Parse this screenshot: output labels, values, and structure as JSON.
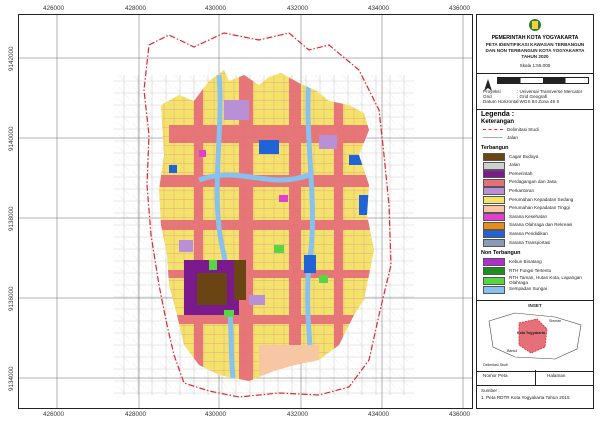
{
  "x_ticks": [
    "426000",
    "428000",
    "430000",
    "432000",
    "434000",
    "436000"
  ],
  "y_ticks": [
    "9142000",
    "9140000",
    "9138000",
    "9136000",
    "9134000"
  ],
  "title_block": {
    "org": "PEMERINTAH KOTA YOGYAKARTA",
    "map_title": "PETA IDENTIFIKASI KAWASAN TERBANGUN DAN NON TERBANGUN KOTA YOGYAKARTA TAHUN 2020",
    "scale": "Skala 1:55.000",
    "proj_labels": [
      "Proyeksi",
      "Grid",
      "Datum Horizontal"
    ],
    "proj_values": [
      ": Universal Transverse Mercator",
      ": Grid Geografi",
      ": WGS 84 Zona 49 S"
    ]
  },
  "legend": {
    "title": "Legenda :",
    "keterangan": "Keterangan",
    "lines": [
      {
        "label": "Delimitasi Studi",
        "color": "#e0262a",
        "style": "dashdot"
      },
      {
        "label": "Jalan",
        "color": "#aaaaaa",
        "style": "solid"
      }
    ],
    "terbangun_title": "Terbangun",
    "terbangun": [
      {
        "label": "Cagar Budaya",
        "color": "#6b4413"
      },
      {
        "label": "Jalan",
        "color": "#cfcfcf"
      },
      {
        "label": "Pemerintah",
        "color": "#7a1a8c"
      },
      {
        "label": "Perdagangan dan Jasa",
        "color": "#e5707a"
      },
      {
        "label": "Perkantoran",
        "color": "#b98fd6"
      },
      {
        "label": "Perumahan Kepadatan Sedang",
        "color": "#f3e36b"
      },
      {
        "label": "Perumahan Kepadatan Tinggi",
        "color": "#f6c7a2"
      },
      {
        "label": "Sarana Kesehatan",
        "color": "#e13fcf"
      },
      {
        "label": "Sarana Olahraga dan Rekreasi",
        "color": "#e88d1a"
      },
      {
        "label": "Sarana Pendidikan",
        "color": "#1f63d6"
      },
      {
        "label": "Sarana Transportasi",
        "color": "#8a99b8"
      }
    ],
    "non_title": "Non Terbangun",
    "non_terbangun": [
      {
        "label": "Kebun Binatang",
        "color": "#b12fd0"
      },
      {
        "label": "RTH Fungsi Tertentu",
        "color": "#1c8f1c"
      },
      {
        "label": "RTH Taman, Hutan Kota, Lapangan Olahraga",
        "color": "#57d644"
      },
      {
        "label": "Sempadan Sungai",
        "color": "#86c1ef"
      }
    ]
  },
  "inset": {
    "title": "INSET",
    "labels": [
      "Kota Yogyakarta",
      "Sleman",
      "Bantul"
    ],
    "note": "Delimitasi Studi"
  },
  "footer": {
    "nomor_label": "Nomor Peta",
    "halaman_label": "Halaman",
    "sumber_title": "Sumber :",
    "sumber": "1. Peta RDTR Kota Yogyakarta Tahun 2015"
  },
  "colors": {
    "boundary": "#e0262a",
    "road": "#d9787e",
    "yellow": "#f3e36b",
    "river": "#86c1ef"
  }
}
